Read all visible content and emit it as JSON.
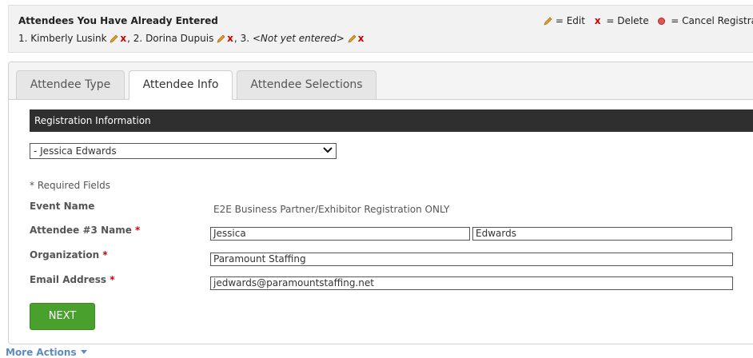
{
  "top": {
    "title": "Attendees You Have Already Entered",
    "legend": {
      "edit": "= Edit",
      "x": "x",
      "delete": "= Delete",
      "cancel": "= Cancel Registrant"
    },
    "attendees": [
      {
        "prefix": "1. ",
        "name": "Kimberly Lusink",
        "x": "x",
        "sep": ","
      },
      {
        "prefix": " 2. ",
        "name": "Dorina Dupuis",
        "x": "x",
        "sep": ","
      },
      {
        "prefix": " 3. ",
        "name": "<Not yet entered>",
        "x": "x"
      }
    ]
  },
  "tabs": [
    {
      "label": "Attendee Type"
    },
    {
      "label": "Attendee Info"
    },
    {
      "label": "Attendee Selections"
    }
  ],
  "active_tab": "Attendee Info",
  "section_header": "Registration Information",
  "attendee_select": {
    "value": "- Jessica Edwards"
  },
  "required_note": "* Required Fields",
  "form": {
    "event_label": "Event Name",
    "event_value": "E2E Business Partner/Exhibitor Registration ONLY",
    "name_label": "Attendee #3 Name",
    "first_name": "Jessica",
    "last_name": "Edwards",
    "org_label": "Organization",
    "org_value": "Paramount Staffing",
    "email_label": "Email Address",
    "email_value": "jedwards@paramountstaffing.net",
    "required_mark": "*"
  },
  "next_button": "NEXT",
  "more_actions": "More Actions",
  "colors": {
    "accent_green": "#4aa02c",
    "delete_red": "#d40000",
    "header_dark": "#2f2f2f",
    "link_blue": "#5b8bbf"
  }
}
